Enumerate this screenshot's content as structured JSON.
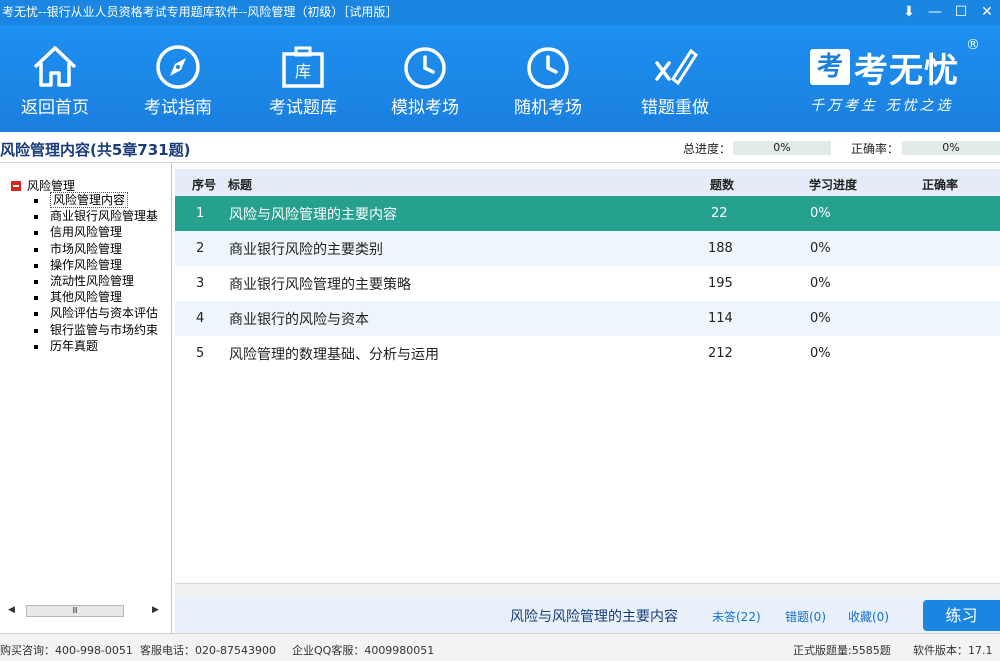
{
  "window": {
    "title": "考无忧--银行从业人员资格考试专用题库软件--风险管理（初级）［试用版］"
  },
  "toolbar": {
    "items": [
      {
        "label": "返回首页",
        "icon": "home-icon"
      },
      {
        "label": "考试指南",
        "icon": "compass-icon"
      },
      {
        "label": "考试题库",
        "icon": "briefcase-icon",
        "icon_text": "库"
      },
      {
        "label": "模拟考场",
        "icon": "clock-icon"
      },
      {
        "label": "随机考场",
        "icon": "clock-icon"
      },
      {
        "label": "错题重做",
        "icon": "error-redo-icon"
      }
    ],
    "logo": {
      "mark": "考",
      "name": "考无忧",
      "reg": "®",
      "slogan": "千万考生 无忧之选"
    }
  },
  "info": {
    "page_title": "风险管理内容(共5章731题)",
    "total_progress_label": "总进度：",
    "total_progress_value": "0%",
    "accuracy_label": "正确率：",
    "accuracy_value": "0%"
  },
  "tree": {
    "root": "风险管理",
    "items": [
      "风险管理内容",
      "商业银行风险管理基",
      "信用风险管理",
      "市场风险管理",
      "操作风险管理",
      "流动性风险管理",
      "其他风险管理",
      "风险评估与资本评估",
      "银行监管与市场约束",
      "历年真题"
    ],
    "selected_index": 0,
    "scroll_thumb": "Ⅲ"
  },
  "table": {
    "headers": {
      "seq": "序号",
      "title": "标题",
      "count": "题数",
      "progress": "学习进度",
      "accuracy": "正确率"
    },
    "rows": [
      {
        "seq": "1",
        "title": "风险与风险管理的主要内容",
        "count": "22",
        "progress": "0%",
        "accuracy": ""
      },
      {
        "seq": "2",
        "title": "商业银行风险的主要类别",
        "count": "188",
        "progress": "0%",
        "accuracy": ""
      },
      {
        "seq": "3",
        "title": "商业银行风险管理的主要策略",
        "count": "195",
        "progress": "0%",
        "accuracy": ""
      },
      {
        "seq": "4",
        "title": "商业银行的风险与资本",
        "count": "114",
        "progress": "0%",
        "accuracy": ""
      },
      {
        "seq": "5",
        "title": "风险管理的数理基础、分析与运用",
        "count": "212",
        "progress": "0%",
        "accuracy": ""
      }
    ]
  },
  "actions": {
    "current_title": "风险与风险管理的主要内容",
    "unanswered": "未答(22)",
    "wrong": "错题(0)",
    "favorites": "收藏(0)",
    "practice": "练习"
  },
  "status": {
    "purchase": "购买咨询：400-998-0051",
    "service_phone": "客服电话：020-87543900",
    "qq_service": "企业QQ客服：4009980051",
    "total_questions": "正式版题量:5585题",
    "version": "软件版本：17.1"
  },
  "colors": {
    "brand_blue": "#1a86e2",
    "selected_row": "#26a18f",
    "header_bg": "#e3ecf7"
  }
}
